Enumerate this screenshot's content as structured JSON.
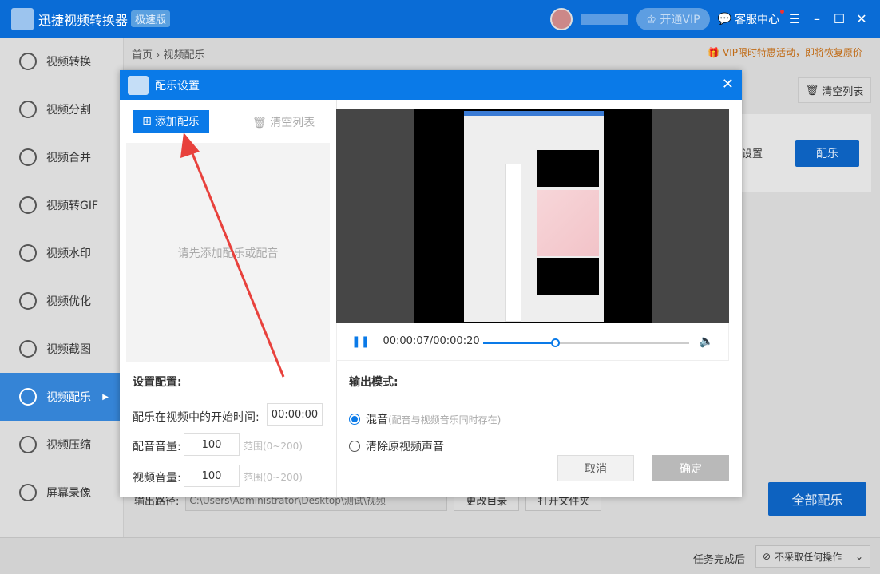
{
  "app": {
    "title": "迅捷视频转换器",
    "edition": "极速版",
    "vip": "开通VIP",
    "service": "客服中心"
  },
  "sidebar": {
    "items": [
      {
        "label": "视频转换",
        "icon": "convert-icon"
      },
      {
        "label": "视频分割",
        "icon": "split-icon"
      },
      {
        "label": "视频合并",
        "icon": "merge-icon"
      },
      {
        "label": "视频转GIF",
        "icon": "gif-icon"
      },
      {
        "label": "视频水印",
        "icon": "watermark-icon"
      },
      {
        "label": "视频优化",
        "icon": "optimize-icon"
      },
      {
        "label": "视频截图",
        "icon": "screenshot-icon"
      },
      {
        "label": "视频配乐",
        "icon": "music-icon",
        "active": true
      },
      {
        "label": "视频压缩",
        "icon": "compress-icon"
      },
      {
        "label": "屏幕录像",
        "icon": "record-icon"
      }
    ]
  },
  "breadcrumb": {
    "home": "首页",
    "current": "视频配乐"
  },
  "promo": "VIP限时特惠活动，即将恢复原价",
  "main": {
    "clear_list": "清空列表",
    "settings_partial": "设置",
    "music_button": "配乐",
    "output_label": "输出路径:",
    "output_path": "C:\\Users\\Administrator\\Desktop\\测试\\视频",
    "change_dir": "更改目录",
    "open_folder": "打开文件夹",
    "all_music": "全部配乐",
    "after_task": "任务完成后",
    "after_option": "不采取任何操作"
  },
  "modal": {
    "title": "配乐设置",
    "add_music": "添加配乐",
    "clear_list": "清空列表",
    "empty_hint": "请先添加配乐或配音",
    "settings_title": "设置配置:",
    "start_label": "配乐在视频中的开始时间:",
    "start_value": "00:00:00",
    "dub_volume_label": "配音音量:",
    "dub_volume": "100",
    "video_volume_label": "视频音量:",
    "video_volume": "100",
    "range": "范围(0~200)",
    "time": "00:00:07/00:00:20",
    "progress_percent": 35,
    "output_mode": "输出模式:",
    "mix": "混音",
    "mix_hint": "(配音与视频音乐同时存在)",
    "remove": "清除原视频声音",
    "selected_mode": "混音",
    "cancel": "取消",
    "ok": "确定"
  },
  "colors": {
    "accent": "#0a7ae8",
    "arrow": "#e8413c"
  }
}
